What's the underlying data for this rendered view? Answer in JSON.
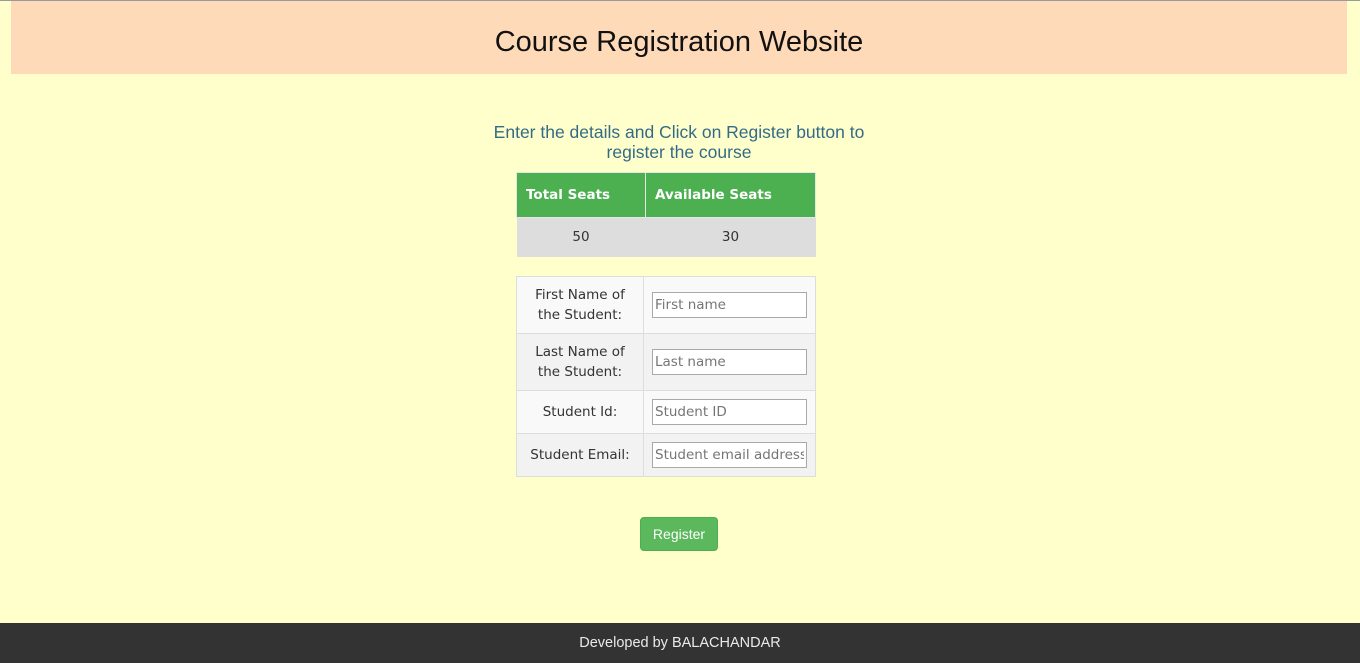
{
  "header": {
    "title": "Course Registration Website"
  },
  "instructions": "Enter the details and Click on Register button to register the course",
  "seats": {
    "headers": [
      "Total Seats",
      "Available Seats"
    ],
    "values": [
      "50",
      "30"
    ]
  },
  "form": {
    "fields": [
      {
        "label": "First Name of the Student:",
        "placeholder": "First name",
        "value": ""
      },
      {
        "label": "Last Name of the Student:",
        "placeholder": "Last name",
        "value": ""
      },
      {
        "label": "Student Id:",
        "placeholder": "Student ID",
        "value": ""
      },
      {
        "label": "Student Email:",
        "placeholder": "Student email address",
        "value": ""
      }
    ]
  },
  "register_label": "Register",
  "footer": {
    "text": "Developed by BALACHANDAR"
  },
  "colors": {
    "page_background": "#ffffcc",
    "header_background": "#ffdab9",
    "table_header": "#4caf50",
    "button": "#5cb85c",
    "footer": "#333333",
    "instruction_text": "#336b87"
  }
}
